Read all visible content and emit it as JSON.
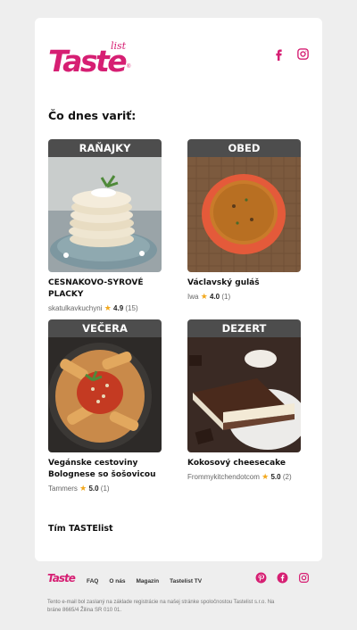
{
  "brand": {
    "logo_main": "Taste",
    "logo_sub": "list",
    "logo_reg": "®",
    "accent": "#d61f73"
  },
  "header": {
    "social": [
      "facebook-icon",
      "instagram-icon"
    ]
  },
  "heading": "Čo dnes variť:",
  "recipes": [
    {
      "category": "RAŇAJKY",
      "title": "CESNAKOVO-SYROVÉ PLACKY",
      "author": "skatulkavkuchyni",
      "rating": "4.9",
      "count": "(15)"
    },
    {
      "category": "OBED",
      "title": "Václavský guláš",
      "author": "Iwa",
      "rating": "4.0",
      "count": "(1)"
    },
    {
      "category": "VEČERA",
      "title": "Vegánske cestoviny Bolognese so šošovicou",
      "author": "Tammers",
      "rating": "5.0",
      "count": "(1)"
    },
    {
      "category": "DEZERT",
      "title": "Kokosový cheesecake",
      "author": "Frommykitchendotcom",
      "rating": "5.0",
      "count": "(2)"
    }
  ],
  "signoff": "Tím TASTElist",
  "footer": {
    "logo": "Taste",
    "nav": [
      "FAQ",
      "O nás",
      "Magazín",
      "Tastelist TV"
    ],
    "social": [
      "pinterest-icon",
      "facebook-icon",
      "instagram-icon"
    ],
    "legal": "Tento e-mail bol zaslaný na základe registrácie na našej stránke spoločnostou Tastelist s.r.o. Na bráne 8665/4 Žilina SR 010 01."
  }
}
